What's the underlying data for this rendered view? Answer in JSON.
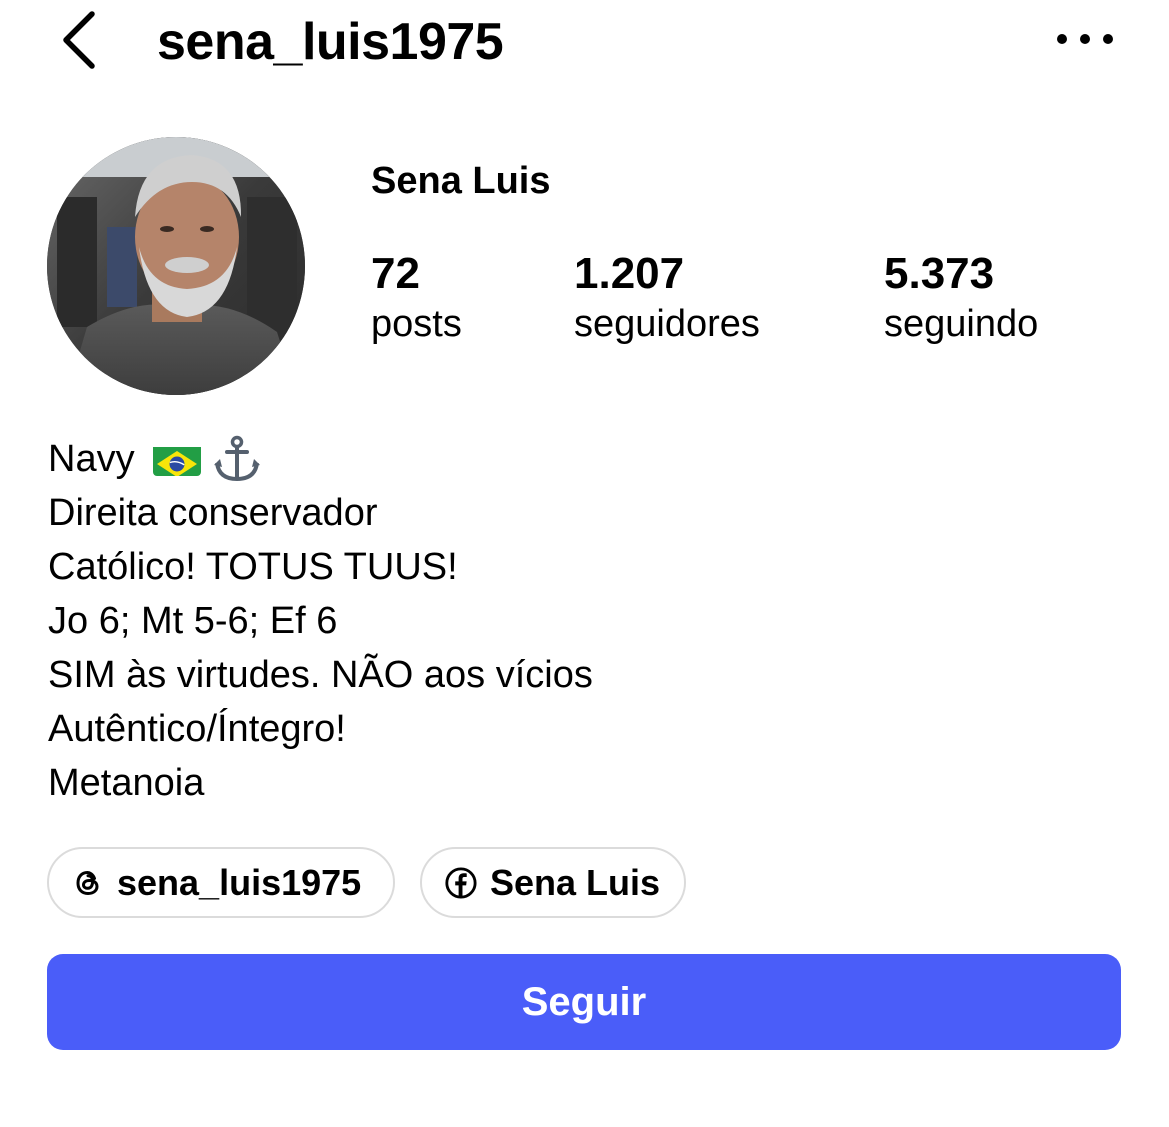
{
  "header": {
    "username": "sena_luis1975",
    "back_icon": "chevron-left-icon",
    "more_icon": "more-horizontal-icon"
  },
  "profile": {
    "display_name": "Sena Luis",
    "stats": [
      {
        "value": "72",
        "label": "posts"
      },
      {
        "value": "1.207",
        "label": "seguidores"
      },
      {
        "value": "5.373",
        "label": "seguindo"
      }
    ]
  },
  "bio": {
    "lines": [
      "Navy",
      "Direita conservador",
      "Católico! TOTUS TUUS!",
      "Jo 6; Mt 5-6; Ef 6",
      "SIM às virtudes. NÃO aos vícios",
      "Autêntico/Íntegro!",
      "Metanoia"
    ],
    "emoji_icons": [
      "brazil-flag-icon",
      "anchor-icon"
    ]
  },
  "links": [
    {
      "icon": "threads-icon",
      "label": "sena_luis1975"
    },
    {
      "icon": "facebook-icon",
      "label": "Sena Luis"
    }
  ],
  "actions": {
    "follow_label": "Seguir"
  },
  "colors": {
    "accent": "#4a5df9",
    "text": "#000000",
    "chip_border": "#dbdbdb"
  }
}
